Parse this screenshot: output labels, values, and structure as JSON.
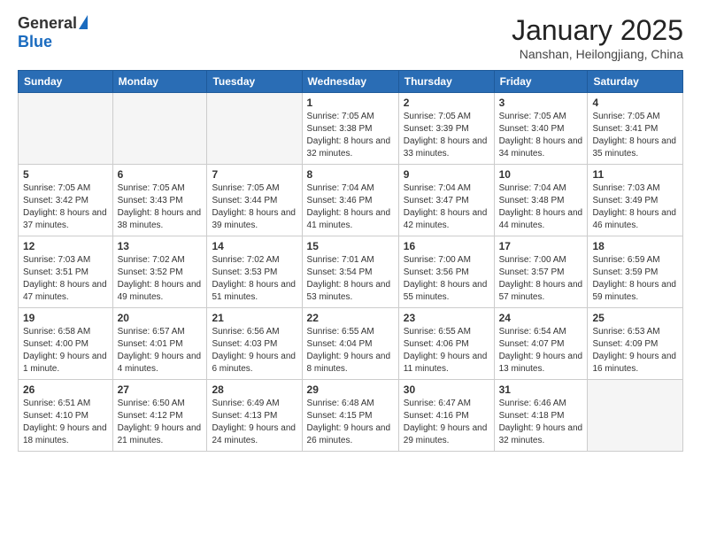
{
  "header": {
    "logo_general": "General",
    "logo_blue": "Blue",
    "month_title": "January 2025",
    "location": "Nanshan, Heilongjiang, China"
  },
  "weekdays": [
    "Sunday",
    "Monday",
    "Tuesday",
    "Wednesday",
    "Thursday",
    "Friday",
    "Saturday"
  ],
  "weeks": [
    [
      {
        "day": "",
        "info": ""
      },
      {
        "day": "",
        "info": ""
      },
      {
        "day": "",
        "info": ""
      },
      {
        "day": "1",
        "info": "Sunrise: 7:05 AM\nSunset: 3:38 PM\nDaylight: 8 hours\nand 32 minutes."
      },
      {
        "day": "2",
        "info": "Sunrise: 7:05 AM\nSunset: 3:39 PM\nDaylight: 8 hours\nand 33 minutes."
      },
      {
        "day": "3",
        "info": "Sunrise: 7:05 AM\nSunset: 3:40 PM\nDaylight: 8 hours\nand 34 minutes."
      },
      {
        "day": "4",
        "info": "Sunrise: 7:05 AM\nSunset: 3:41 PM\nDaylight: 8 hours\nand 35 minutes."
      }
    ],
    [
      {
        "day": "5",
        "info": "Sunrise: 7:05 AM\nSunset: 3:42 PM\nDaylight: 8 hours\nand 37 minutes."
      },
      {
        "day": "6",
        "info": "Sunrise: 7:05 AM\nSunset: 3:43 PM\nDaylight: 8 hours\nand 38 minutes."
      },
      {
        "day": "7",
        "info": "Sunrise: 7:05 AM\nSunset: 3:44 PM\nDaylight: 8 hours\nand 39 minutes."
      },
      {
        "day": "8",
        "info": "Sunrise: 7:04 AM\nSunset: 3:46 PM\nDaylight: 8 hours\nand 41 minutes."
      },
      {
        "day": "9",
        "info": "Sunrise: 7:04 AM\nSunset: 3:47 PM\nDaylight: 8 hours\nand 42 minutes."
      },
      {
        "day": "10",
        "info": "Sunrise: 7:04 AM\nSunset: 3:48 PM\nDaylight: 8 hours\nand 44 minutes."
      },
      {
        "day": "11",
        "info": "Sunrise: 7:03 AM\nSunset: 3:49 PM\nDaylight: 8 hours\nand 46 minutes."
      }
    ],
    [
      {
        "day": "12",
        "info": "Sunrise: 7:03 AM\nSunset: 3:51 PM\nDaylight: 8 hours\nand 47 minutes."
      },
      {
        "day": "13",
        "info": "Sunrise: 7:02 AM\nSunset: 3:52 PM\nDaylight: 8 hours\nand 49 minutes."
      },
      {
        "day": "14",
        "info": "Sunrise: 7:02 AM\nSunset: 3:53 PM\nDaylight: 8 hours\nand 51 minutes."
      },
      {
        "day": "15",
        "info": "Sunrise: 7:01 AM\nSunset: 3:54 PM\nDaylight: 8 hours\nand 53 minutes."
      },
      {
        "day": "16",
        "info": "Sunrise: 7:00 AM\nSunset: 3:56 PM\nDaylight: 8 hours\nand 55 minutes."
      },
      {
        "day": "17",
        "info": "Sunrise: 7:00 AM\nSunset: 3:57 PM\nDaylight: 8 hours\nand 57 minutes."
      },
      {
        "day": "18",
        "info": "Sunrise: 6:59 AM\nSunset: 3:59 PM\nDaylight: 8 hours\nand 59 minutes."
      }
    ],
    [
      {
        "day": "19",
        "info": "Sunrise: 6:58 AM\nSunset: 4:00 PM\nDaylight: 9 hours\nand 1 minute."
      },
      {
        "day": "20",
        "info": "Sunrise: 6:57 AM\nSunset: 4:01 PM\nDaylight: 9 hours\nand 4 minutes."
      },
      {
        "day": "21",
        "info": "Sunrise: 6:56 AM\nSunset: 4:03 PM\nDaylight: 9 hours\nand 6 minutes."
      },
      {
        "day": "22",
        "info": "Sunrise: 6:55 AM\nSunset: 4:04 PM\nDaylight: 9 hours\nand 8 minutes."
      },
      {
        "day": "23",
        "info": "Sunrise: 6:55 AM\nSunset: 4:06 PM\nDaylight: 9 hours\nand 11 minutes."
      },
      {
        "day": "24",
        "info": "Sunrise: 6:54 AM\nSunset: 4:07 PM\nDaylight: 9 hours\nand 13 minutes."
      },
      {
        "day": "25",
        "info": "Sunrise: 6:53 AM\nSunset: 4:09 PM\nDaylight: 9 hours\nand 16 minutes."
      }
    ],
    [
      {
        "day": "26",
        "info": "Sunrise: 6:51 AM\nSunset: 4:10 PM\nDaylight: 9 hours\nand 18 minutes."
      },
      {
        "day": "27",
        "info": "Sunrise: 6:50 AM\nSunset: 4:12 PM\nDaylight: 9 hours\nand 21 minutes."
      },
      {
        "day": "28",
        "info": "Sunrise: 6:49 AM\nSunset: 4:13 PM\nDaylight: 9 hours\nand 24 minutes."
      },
      {
        "day": "29",
        "info": "Sunrise: 6:48 AM\nSunset: 4:15 PM\nDaylight: 9 hours\nand 26 minutes."
      },
      {
        "day": "30",
        "info": "Sunrise: 6:47 AM\nSunset: 4:16 PM\nDaylight: 9 hours\nand 29 minutes."
      },
      {
        "day": "31",
        "info": "Sunrise: 6:46 AM\nSunset: 4:18 PM\nDaylight: 9 hours\nand 32 minutes."
      },
      {
        "day": "",
        "info": ""
      }
    ]
  ]
}
